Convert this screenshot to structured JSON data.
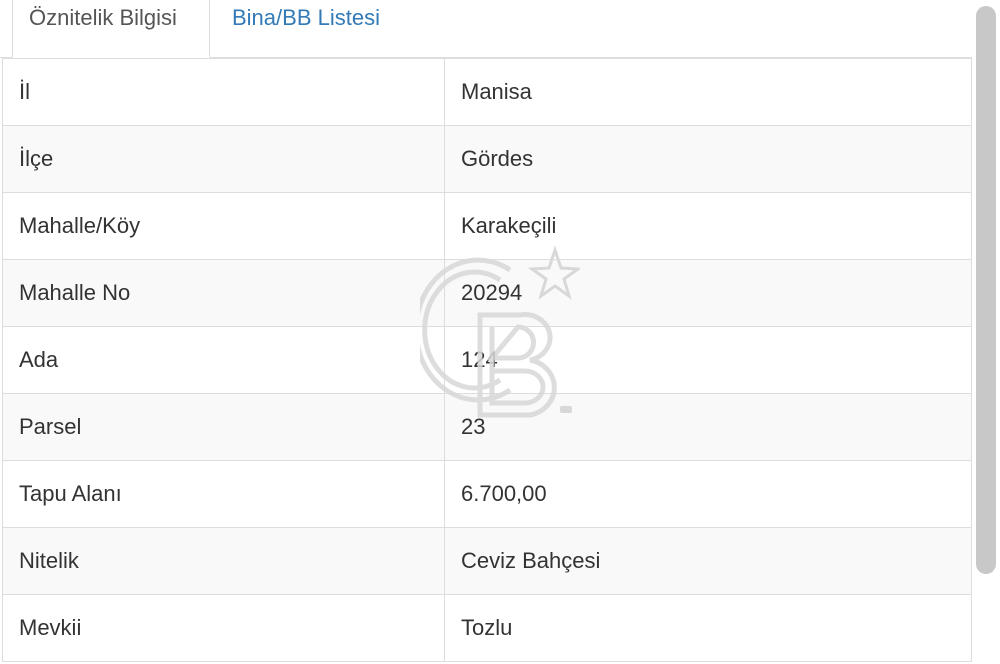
{
  "tabs": [
    {
      "label": "Öznitelik Bilgisi",
      "active": true
    },
    {
      "label": "Bina/BB Listesi",
      "active": false
    }
  ],
  "rows": [
    {
      "label": "İl",
      "value": "Manisa"
    },
    {
      "label": "İlçe",
      "value": "Gördes"
    },
    {
      "label": "Mahalle/Köy",
      "value": "Karakeçili"
    },
    {
      "label": "Mahalle No",
      "value": "20294"
    },
    {
      "label": "Ada",
      "value": "124"
    },
    {
      "label": "Parsel",
      "value": "23"
    },
    {
      "label": "Tapu Alanı",
      "value": "6.700,00"
    },
    {
      "label": "Nitelik",
      "value": "Ceviz Bahçesi"
    },
    {
      "label": "Mevkii",
      "value": "Tozlu"
    }
  ],
  "watermark": {
    "icon": "cb-logo-icon"
  }
}
